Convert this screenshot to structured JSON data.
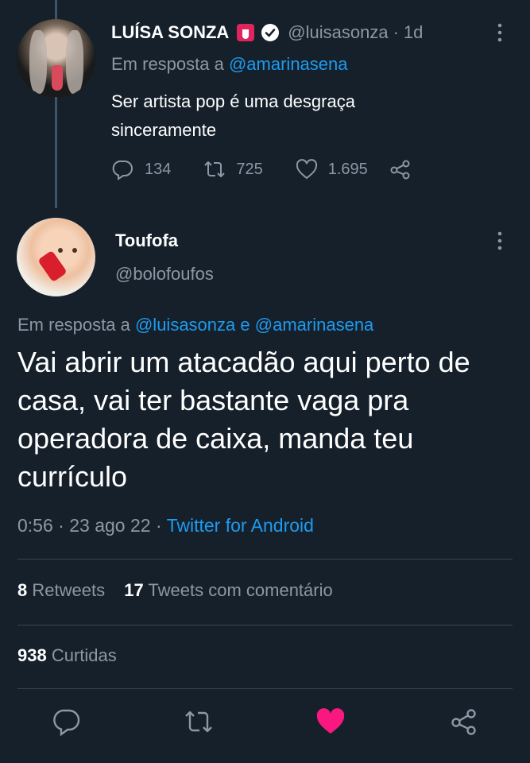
{
  "colors": {
    "background": "#15202b",
    "accent": "#1d9bf0",
    "muted": "#8b98a5",
    "like": "#f91880"
  },
  "reply_tweet": {
    "name": "LUÍSA SONZA",
    "handle": "@luisasonza",
    "separator": "·",
    "time": "1d",
    "replying_prefix": "Em resposta a",
    "replying_to": "@amarinasena",
    "text": "Ser artista pop é uma desgraça sinceramente",
    "replies": "134",
    "retweets": "725",
    "likes": "1.695",
    "icons": [
      "tongue-emoji-icon",
      "verified-icon",
      "more-icon",
      "reply-icon",
      "retweet-icon",
      "like-icon",
      "share-icon"
    ]
  },
  "main_tweet": {
    "name": "Toufofa",
    "handle": "@bolofoufos",
    "replying_prefix": "Em resposta a",
    "replying_to_1": "@luisasonza",
    "replying_and": "e",
    "replying_to_2": "@amarinasena",
    "text": "Vai abrir um atacadão aqui perto de casa, vai ter bastante vaga pra operadora de caixa, manda teu currículo",
    "time": "0:56",
    "date": "23 ago 22",
    "separator": "·",
    "client": "Twitter for Android",
    "retweets_count": "8",
    "retweets_label": "Retweets",
    "quotes_count": "17",
    "quotes_label": "Tweets com comentário",
    "likes_count": "938",
    "likes_label": "Curtidas"
  },
  "action_bar": {
    "icons": [
      "reply-icon",
      "retweet-icon",
      "like-icon-filled",
      "share-icon"
    ]
  }
}
